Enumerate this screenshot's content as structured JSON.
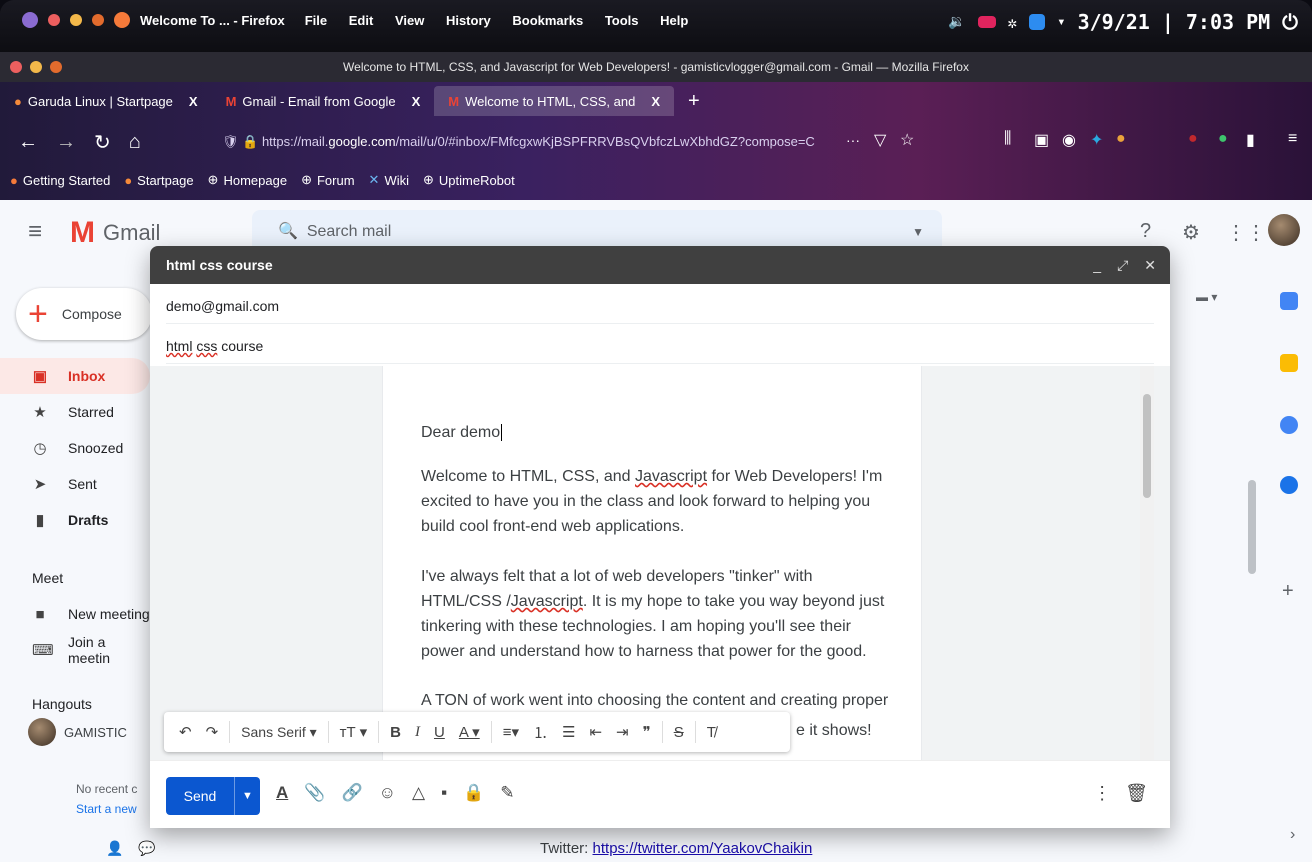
{
  "os": {
    "app_title": "Welcome To ... - Firefox",
    "menu": [
      "File",
      "Edit",
      "View",
      "History",
      "Bookmarks",
      "Tools",
      "Help"
    ],
    "date": "3/9/21",
    "time": "7:03 PM",
    "power_icon": "power-icon"
  },
  "window": {
    "title": "Welcome to HTML, CSS, and Javascript for Web Developers! - gamisticvlogger@gmail.com - Gmail — Mozilla Firefox"
  },
  "tabs": [
    {
      "label": "Garuda Linux | Startpage",
      "close": "X"
    },
    {
      "label": "Gmail - Email from Google",
      "close": "X"
    },
    {
      "label": "Welcome to HTML, CSS, and",
      "close": "X"
    }
  ],
  "new_tab": "+",
  "address": {
    "prefix": "https://mail.",
    "domain": "google.com",
    "suffix": "/mail/u/0/#inbox/FMfcgxwKjBSPFRRVBsQVbfczLwXbhdGZ?compose=C",
    "more": "···"
  },
  "bookmarks": [
    "Getting Started",
    "Startpage",
    "Homepage",
    "Forum",
    "Wiki",
    "UptimeRobot"
  ],
  "gmail": {
    "logo_text": "Gmail",
    "search_placeholder": "Search mail",
    "compose_label": "Compose",
    "nav": [
      {
        "label": "Inbox",
        "icon": "inbox-icon"
      },
      {
        "label": "Starred",
        "icon": "star-icon"
      },
      {
        "label": "Snoozed",
        "icon": "clock-icon"
      },
      {
        "label": "Sent",
        "icon": "send-icon"
      },
      {
        "label": "Drafts",
        "icon": "draft-icon"
      }
    ],
    "meet_heading": "Meet",
    "meet_items": [
      "New meeting",
      "Join a meetin"
    ],
    "hangouts_heading": "Hangouts",
    "hangouts_user": "GAMISTIC",
    "no_recent": "No recent c",
    "start_new": "Start a new"
  },
  "compose": {
    "title": "html css course",
    "to": "demo@gmail.com",
    "subject_word1": "html",
    "subject_word2": "css",
    "subject_word3": "course",
    "greeting": "Dear demo",
    "p1_a": "Welcome to HTML, CSS, and ",
    "p1_js": "Javascript",
    "p1_b": " for Web Developers! I'm excited to have you in the class and look forward to helping you build cool front-end web applications.",
    "p2_a": "I've always felt that a lot of web developers \"tinker\" with HTML/CSS /",
    "p2_js": "Javascript",
    "p2_b": ". It is my hope to take you way beyond just tinkering with these technologies. I am hoping you'll see their power and understand how to harness that power for the good.",
    "p3": "A TON of work went into choosing the content and creating proper",
    "p3_tail": "e it shows!",
    "font_name": "Sans Serif",
    "send_label": "Send"
  },
  "below": {
    "twitter_label": "Twitter: ",
    "twitter_url": "https://twitter.com/YaakovChaikin"
  }
}
